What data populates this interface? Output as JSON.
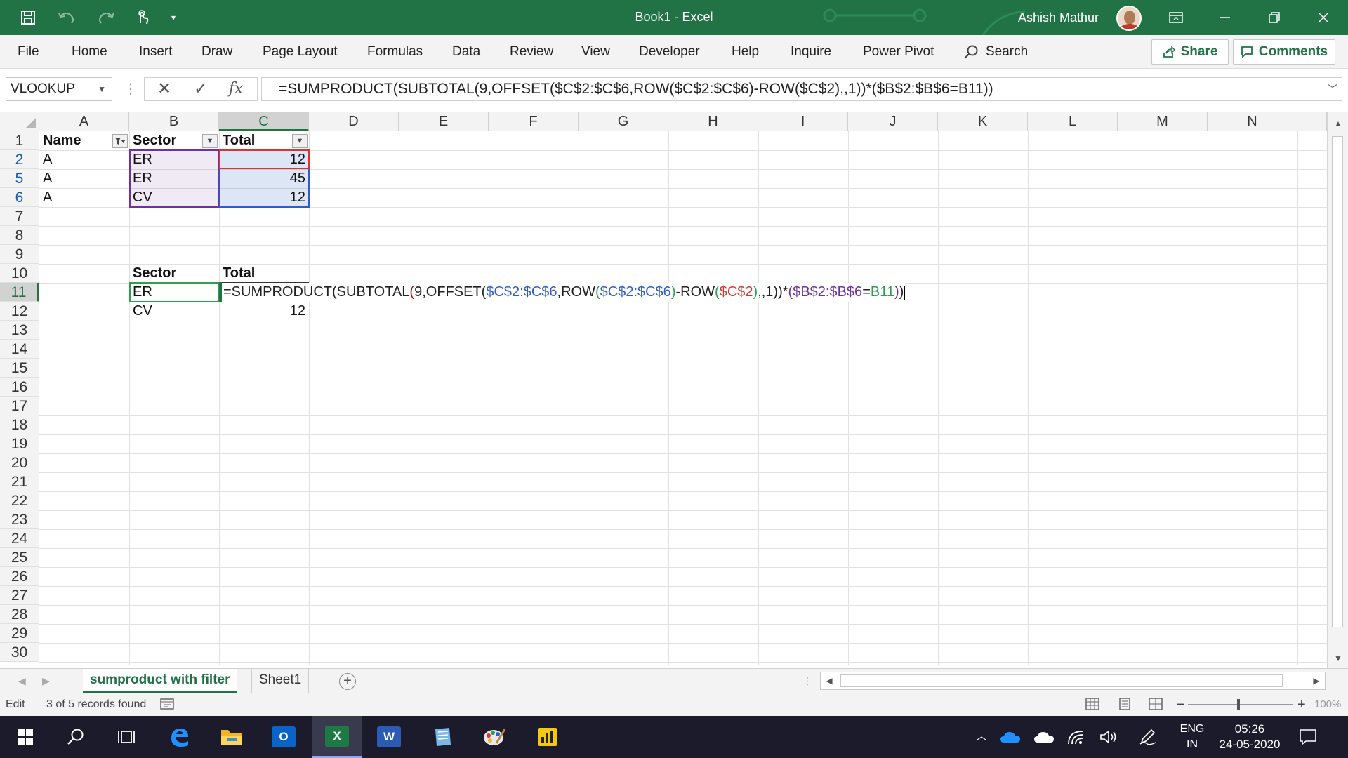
{
  "titlebar": {
    "doc_title": "Book1  -  Excel",
    "user_name": "Ashish Mathur",
    "bg_color": "#217346"
  },
  "ribbon": {
    "tabs": [
      "File",
      "Home",
      "Insert",
      "Draw",
      "Page Layout",
      "Formulas",
      "Data",
      "Review",
      "View",
      "Developer",
      "Help",
      "Inquire",
      "Power Pivot"
    ],
    "search_label": "Search",
    "share_label": "Share",
    "comments_label": "Comments"
  },
  "formula_bar": {
    "name_box": "VLOOKUP",
    "fx_label": "fx",
    "formula": "=SUMPRODUCT(SUBTOTAL(9,OFFSET($C$2:$C$6,ROW($C$2:$C$6)-ROW($C$2),,1))*($B$2:$B$6=B11))"
  },
  "grid": {
    "columns": [
      "A",
      "B",
      "C",
      "D",
      "E",
      "F",
      "G",
      "H",
      "I",
      "J",
      "K",
      "L",
      "M",
      "N"
    ],
    "rows": [
      "1",
      "2",
      "5",
      "6",
      "7",
      "8",
      "9",
      "10",
      "11",
      "12",
      "13",
      "14",
      "15",
      "16",
      "17",
      "18",
      "19",
      "20",
      "21",
      "22",
      "23",
      "24",
      "25",
      "26",
      "27",
      "28",
      "29",
      "30"
    ],
    "table_headers": {
      "name": "Name",
      "sector": "Sector",
      "total": "Total"
    },
    "table_rows": [
      {
        "name": "A",
        "sector": "ER",
        "total": "12"
      },
      {
        "name": "A",
        "sector": "ER",
        "total": "45"
      },
      {
        "name": "A",
        "sector": "CV",
        "total": "12"
      }
    ],
    "summary_headers": {
      "sector": "Sector",
      "total": "Total"
    },
    "summary_rows": [
      {
        "sector": "ER"
      },
      {
        "sector": "CV",
        "total": "12"
      }
    ],
    "edit_formula_parts": [
      {
        "text": "=SUMPRODUCT(SUBTOTAL",
        "color": "#222222"
      },
      {
        "text": "(",
        "color": "#c00000"
      },
      {
        "text": "9,OFFSET",
        "color": "#222222"
      },
      {
        "text": "(",
        "color": "#222222"
      },
      {
        "text": "$C$2:$C$6",
        "color": "#2e5bd0"
      },
      {
        "text": ",ROW",
        "color": "#222222"
      },
      {
        "text": "(",
        "color": "#2e9e4f"
      },
      {
        "text": "$C$2:$C$6",
        "color": "#2e5bd0"
      },
      {
        "text": ")",
        "color": "#2e9e4f"
      },
      {
        "text": "-ROW",
        "color": "#222222"
      },
      {
        "text": "(",
        "color": "#2e9e4f"
      },
      {
        "text": "$C$2",
        "color": "#e03030"
      },
      {
        "text": ")",
        "color": "#2e9e4f"
      },
      {
        "text": ",,1))*",
        "color": "#222222"
      },
      {
        "text": "(",
        "color": "#7030a0"
      },
      {
        "text": "$B$2:$B$6",
        "color": "#7030a0"
      },
      {
        "text": "=",
        "color": "#222222"
      },
      {
        "text": "B11",
        "color": "#2e9e4f"
      },
      {
        "text": ")",
        "color": "#7030a0"
      },
      {
        "text": ")",
        "color": "#222222"
      }
    ]
  },
  "sheets": {
    "tabs": [
      "sumproduct with filter",
      "Sheet1"
    ],
    "active": "sumproduct with filter"
  },
  "statusbar": {
    "mode": "Edit",
    "records": "3 of 5 records found",
    "zoom": "100%"
  },
  "taskbar": {
    "lang_line1": "ENG",
    "lang_line2": "IN",
    "time": "05:26",
    "date": "24-05-2020"
  }
}
